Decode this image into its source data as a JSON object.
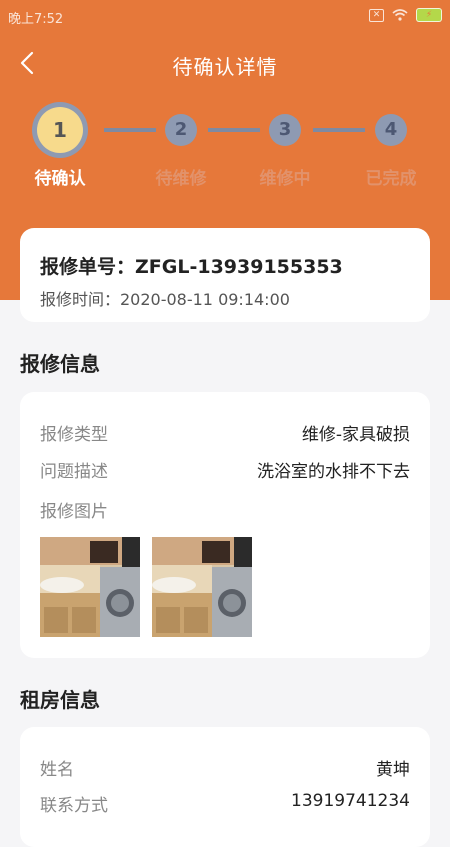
{
  "statusbar": {
    "time": "晚上7:52",
    "sim": "✕",
    "battery": "⚡"
  },
  "header": {
    "title": "待确认详情"
  },
  "steps": [
    {
      "num": "1",
      "label": "待确认"
    },
    {
      "num": "2",
      "label": "待维修"
    },
    {
      "num": "3",
      "label": "维修中"
    },
    {
      "num": "4",
      "label": "已完成"
    }
  ],
  "order": {
    "number": "报修单号：ZFGL-13939155353",
    "time": "报修时间：2020-08-11 09:14:00"
  },
  "repair_info": {
    "title": "报修信息",
    "type_label": "报修类型",
    "type_value": "维修-家具破损",
    "desc_label": "问题描述",
    "desc_value": "洗浴室的水排不下去",
    "photos_label": "报修图片"
  },
  "rental_info": {
    "title": "租房信息",
    "name_label": "姓名",
    "name_value": "黄坤",
    "contact_label": "联系方式",
    "contact_value": "13919741234"
  },
  "colors": {
    "accent": "#e6783a",
    "step_inactive": "#8e9ab2",
    "step_active": "#f7da8c"
  }
}
